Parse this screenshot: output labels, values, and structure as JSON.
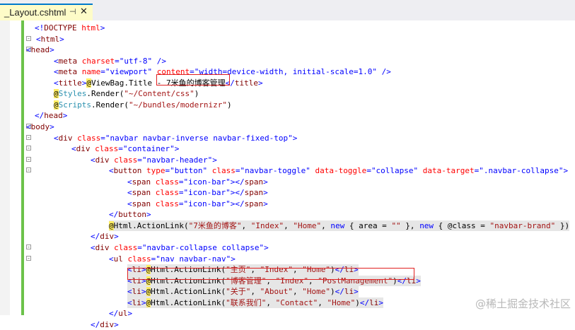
{
  "tab": {
    "title": "_Layout.cshtml",
    "pin_glyph": "⊣",
    "close_glyph": "✕"
  },
  "lines": [
    [
      [
        "br",
        "<!"
      ],
      [
        "tag",
        "DOCTYPE"
      ],
      [
        "plain",
        " "
      ],
      [
        "attr",
        "html"
      ],
      [
        "br",
        ">"
      ]
    ],
    [
      [
        "br",
        "<"
      ],
      [
        "tag",
        "html"
      ],
      [
        "br",
        ">"
      ]
    ],
    [
      [
        "br",
        "<"
      ],
      [
        "tag",
        "head"
      ],
      [
        "br",
        ">"
      ]
    ],
    [
      [
        "br",
        "<"
      ],
      [
        "tag",
        "meta"
      ],
      [
        "plain",
        " "
      ],
      [
        "attr",
        "charset"
      ],
      [
        "br",
        "="
      ],
      [
        "val",
        "\"utf-8\""
      ],
      [
        "plain",
        " "
      ],
      [
        "br",
        "/>"
      ]
    ],
    [
      [
        "br",
        "<"
      ],
      [
        "tag",
        "meta"
      ],
      [
        "plain",
        " "
      ],
      [
        "attr",
        "name"
      ],
      [
        "br",
        "="
      ],
      [
        "val",
        "\"viewport\""
      ],
      [
        "plain",
        " "
      ],
      [
        "attr",
        "content"
      ],
      [
        "br",
        "="
      ],
      [
        "val",
        "\"width=device-width, initial-scale=1.0\""
      ],
      [
        "plain",
        " "
      ],
      [
        "br",
        "/>"
      ]
    ],
    [
      [
        "br",
        "<"
      ],
      [
        "tag",
        "title"
      ],
      [
        "br",
        ">"
      ],
      [
        "razor",
        "@"
      ],
      [
        "txt",
        "ViewBag.Title - 7米鱼的博客管理"
      ],
      [
        "br",
        "</"
      ],
      [
        "tag",
        "title"
      ],
      [
        "br",
        ">"
      ]
    ],
    [
      [
        "razor",
        "@"
      ],
      [
        "cls",
        "Styles"
      ],
      [
        "txt",
        "."
      ],
      [
        "plain",
        "Render("
      ],
      [
        "str",
        "\"~/Content/css\""
      ],
      [
        "plain",
        ")"
      ]
    ],
    [
      [
        "razor",
        "@"
      ],
      [
        "cls",
        "Scripts"
      ],
      [
        "txt",
        "."
      ],
      [
        "plain",
        "Render("
      ],
      [
        "str",
        "\"~/bundles/modernizr\""
      ],
      [
        "plain",
        ")"
      ]
    ],
    [
      [
        "br",
        "</"
      ],
      [
        "tag",
        "head"
      ],
      [
        "br",
        ">"
      ]
    ],
    [
      [
        "br",
        "<"
      ],
      [
        "tag",
        "body"
      ],
      [
        "br",
        ">"
      ]
    ],
    [
      [
        "br",
        "<"
      ],
      [
        "tag",
        "div"
      ],
      [
        "plain",
        " "
      ],
      [
        "attr",
        "class"
      ],
      [
        "br",
        "="
      ],
      [
        "val",
        "\"navbar navbar-inverse navbar-fixed-top\""
      ],
      [
        "br",
        ">"
      ]
    ],
    [
      [
        "br",
        "<"
      ],
      [
        "tag",
        "div"
      ],
      [
        "plain",
        " "
      ],
      [
        "attr",
        "class"
      ],
      [
        "br",
        "="
      ],
      [
        "val",
        "\"container\""
      ],
      [
        "br",
        ">"
      ]
    ],
    [
      [
        "br",
        "<"
      ],
      [
        "tag",
        "div"
      ],
      [
        "plain",
        " "
      ],
      [
        "attr",
        "class"
      ],
      [
        "br",
        "="
      ],
      [
        "val",
        "\"navbar-header\""
      ],
      [
        "br",
        ">"
      ]
    ],
    [
      [
        "br",
        "<"
      ],
      [
        "tag",
        "button"
      ],
      [
        "plain",
        " "
      ],
      [
        "attr",
        "type"
      ],
      [
        "br",
        "="
      ],
      [
        "val",
        "\"button\""
      ],
      [
        "plain",
        " "
      ],
      [
        "attr",
        "class"
      ],
      [
        "br",
        "="
      ],
      [
        "val",
        "\"navbar-toggle\""
      ],
      [
        "plain",
        " "
      ],
      [
        "attr",
        "data-toggle"
      ],
      [
        "br",
        "="
      ],
      [
        "val",
        "\"collapse\""
      ],
      [
        "plain",
        " "
      ],
      [
        "attr",
        "data-target"
      ],
      [
        "br",
        "="
      ],
      [
        "val",
        "\".navbar-collapse\""
      ],
      [
        "br",
        ">"
      ]
    ],
    [
      [
        "br",
        "<"
      ],
      [
        "tag",
        "span"
      ],
      [
        "plain",
        " "
      ],
      [
        "attr",
        "class"
      ],
      [
        "br",
        "="
      ],
      [
        "val",
        "\"icon-bar\""
      ],
      [
        "br",
        "></"
      ],
      [
        "tag",
        "span"
      ],
      [
        "br",
        ">"
      ]
    ],
    [
      [
        "br",
        "<"
      ],
      [
        "tag",
        "span"
      ],
      [
        "plain",
        " "
      ],
      [
        "attr",
        "class"
      ],
      [
        "br",
        "="
      ],
      [
        "val",
        "\"icon-bar\""
      ],
      [
        "br",
        "></"
      ],
      [
        "tag",
        "span"
      ],
      [
        "br",
        ">"
      ]
    ],
    [
      [
        "br",
        "<"
      ],
      [
        "tag",
        "span"
      ],
      [
        "plain",
        " "
      ],
      [
        "attr",
        "class"
      ],
      [
        "br",
        "="
      ],
      [
        "val",
        "\"icon-bar\""
      ],
      [
        "br",
        "></"
      ],
      [
        "tag",
        "span"
      ],
      [
        "br",
        ">"
      ]
    ],
    [
      [
        "br",
        "</"
      ],
      [
        "tag",
        "button"
      ],
      [
        "br",
        ">"
      ]
    ],
    [
      [
        "razor",
        "@"
      ],
      [
        "plain",
        "Html.ActionLink("
      ],
      [
        "str",
        "\"7米鱼的博客\""
      ],
      [
        "plain",
        ", "
      ],
      [
        "str",
        "\"Index\""
      ],
      [
        "plain",
        ", "
      ],
      [
        "str",
        "\"Home\""
      ],
      [
        "plain",
        ", "
      ],
      [
        "kw",
        "new"
      ],
      [
        "plain",
        " { area = "
      ],
      [
        "str",
        "\"\""
      ],
      [
        "plain",
        " }, "
      ],
      [
        "kw",
        "new"
      ],
      [
        "plain",
        " { @class = "
      ],
      [
        "str",
        "\"navbar-brand\""
      ],
      [
        "plain",
        " })"
      ]
    ],
    [
      [
        "br",
        "</"
      ],
      [
        "tag",
        "div"
      ],
      [
        "br",
        ">"
      ]
    ],
    [
      [
        "br",
        "<"
      ],
      [
        "tag",
        "div"
      ],
      [
        "plain",
        " "
      ],
      [
        "attr",
        "class"
      ],
      [
        "br",
        "="
      ],
      [
        "val",
        "\"navbar-collapse collapse\""
      ],
      [
        "br",
        ">"
      ]
    ],
    [
      [
        "br",
        "<"
      ],
      [
        "tag",
        "ul"
      ],
      [
        "plain",
        " "
      ],
      [
        "attr",
        "class"
      ],
      [
        "br",
        "="
      ],
      [
        "val",
        "\"nav navbar-nav\""
      ],
      [
        "br",
        ">"
      ]
    ],
    [
      [
        "br",
        "<"
      ],
      [
        "tag",
        "li"
      ],
      [
        "br",
        ">"
      ],
      [
        "razor",
        "@"
      ],
      [
        "plain",
        "Html.ActionLink("
      ],
      [
        "str",
        "\"主页\""
      ],
      [
        "plain",
        ", "
      ],
      [
        "str",
        "\"Index\""
      ],
      [
        "plain",
        ", "
      ],
      [
        "str",
        "\"Home\""
      ],
      [
        "plain",
        ")"
      ],
      [
        "br",
        "</"
      ],
      [
        "tag",
        "li"
      ],
      [
        "br",
        ">"
      ]
    ],
    [
      [
        "br",
        "<"
      ],
      [
        "tag",
        "li"
      ],
      [
        "br",
        ">"
      ],
      [
        "razor",
        "@"
      ],
      [
        "plain",
        "Html.ActionLink("
      ],
      [
        "str",
        "\"博客管理\""
      ],
      [
        "plain",
        ", "
      ],
      [
        "str",
        "\"Index\""
      ],
      [
        "plain",
        ", "
      ],
      [
        "str",
        "\"PostManagement\""
      ],
      [
        "plain",
        ")"
      ],
      [
        "br",
        "</"
      ],
      [
        "tag",
        "li"
      ],
      [
        "br",
        ">"
      ]
    ],
    [
      [
        "br",
        "<"
      ],
      [
        "tag",
        "li"
      ],
      [
        "br",
        ">"
      ],
      [
        "razor",
        "@"
      ],
      [
        "plain",
        "Html.ActionLink("
      ],
      [
        "str",
        "\"关于\""
      ],
      [
        "plain",
        ", "
      ],
      [
        "str",
        "\"About\""
      ],
      [
        "plain",
        ", "
      ],
      [
        "str",
        "\"Home\""
      ],
      [
        "plain",
        ")"
      ],
      [
        "br",
        "</"
      ],
      [
        "tag",
        "li"
      ],
      [
        "br",
        ">"
      ]
    ],
    [
      [
        "br",
        "<"
      ],
      [
        "tag",
        "li"
      ],
      [
        "br",
        ">"
      ],
      [
        "razor",
        "@"
      ],
      [
        "plain",
        "Html.ActionLink("
      ],
      [
        "str",
        "\"联系我们\""
      ],
      [
        "plain",
        ", "
      ],
      [
        "str",
        "\"Contact\""
      ],
      [
        "plain",
        ", "
      ],
      [
        "str",
        "\"Home\""
      ],
      [
        "plain",
        ")"
      ],
      [
        "br",
        "</"
      ],
      [
        "tag",
        "li"
      ],
      [
        "br",
        ">"
      ]
    ],
    [
      [
        "br",
        "</"
      ],
      [
        "tag",
        "ul"
      ],
      [
        "br",
        ">"
      ]
    ],
    [
      [
        "br",
        "</"
      ],
      [
        "tag",
        "div"
      ],
      [
        "br",
        ">"
      ]
    ]
  ],
  "watermark": "@稀土掘金技术社区"
}
